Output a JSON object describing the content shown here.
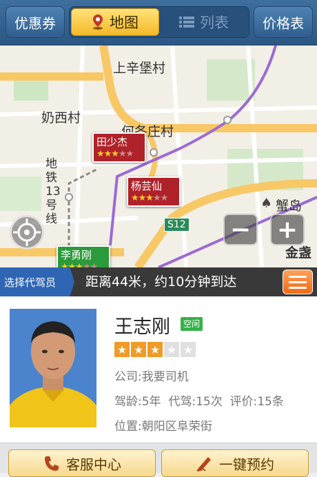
{
  "topbar": {
    "coupon": "优惠券",
    "map_tab": "地图",
    "list_tab": "列表",
    "price": "价格表"
  },
  "map": {
    "labels": [
      "上辛堡村",
      "奶西村",
      "何各庄村",
      "地铁13号线",
      "蟹岛",
      "S12",
      "金盏"
    ],
    "drivers": [
      {
        "name": "田少杰",
        "stars": 3
      },
      {
        "name": "杨芸仙",
        "stars": 3
      },
      {
        "name": "李勇刚",
        "stars": 3
      }
    ]
  },
  "infobar": {
    "choose": "选择代驾员",
    "distance": "距离44米，约10分钟到达"
  },
  "driver": {
    "name": "王志刚",
    "status": "空闲",
    "rating": 3,
    "max_rating": 5,
    "company": "公司:我要司机",
    "stats": "驾龄:5年  代驾:15次  评价:15条",
    "location": "位置:朝阳区阜荣街"
  },
  "actions": {
    "service": "客服中心",
    "book": "一键预约"
  },
  "colors": {
    "topbar": "#2c5784",
    "accent": "#f4b928",
    "pin_red": "#b0222a",
    "status_green": "#35b14a"
  }
}
